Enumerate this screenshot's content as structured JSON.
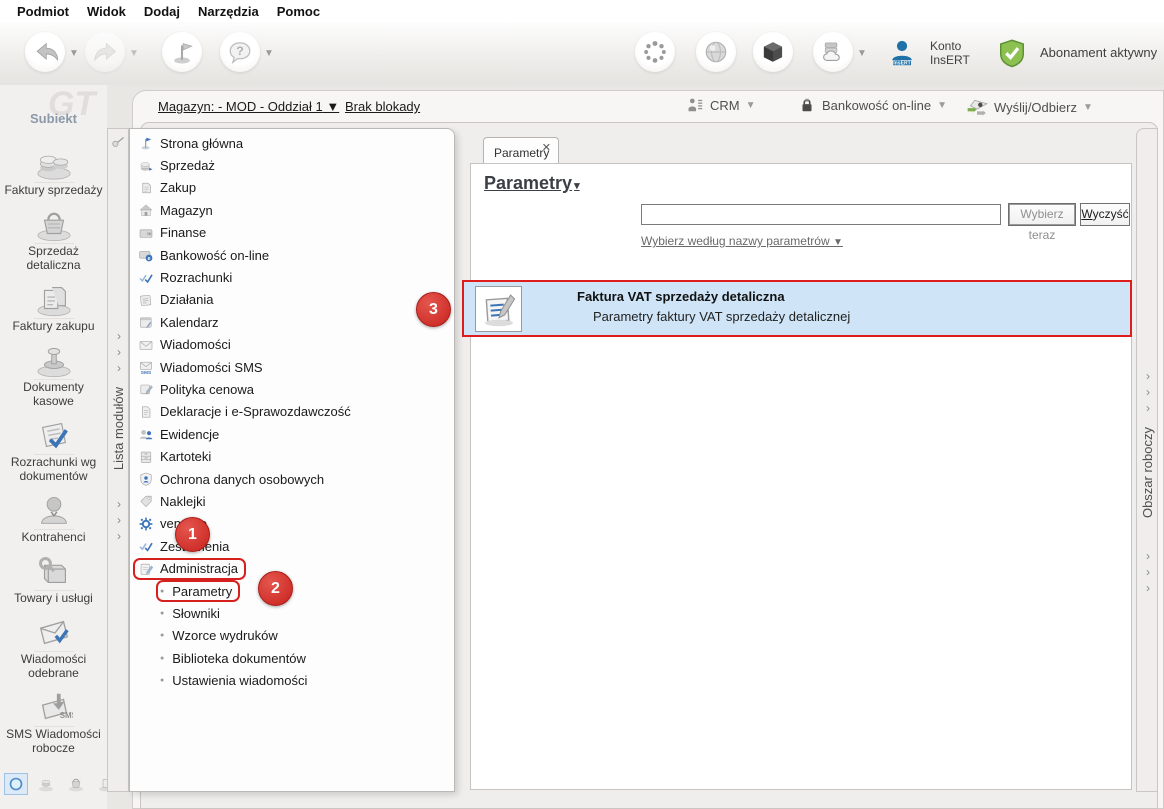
{
  "menu": {
    "items": [
      "Podmiot",
      "Widok",
      "Dodaj",
      "Narzędzia",
      "Pomoc"
    ]
  },
  "toolbar": {
    "left_buttons": [
      {
        "icon": "nav-back-icon",
        "caret": true,
        "disabled": false
      },
      {
        "icon": "nav-forward-icon",
        "caret": true,
        "disabled": true
      },
      {
        "icon": "flag-icon",
        "caret": false,
        "disabled": false
      },
      {
        "icon": "help-bubble-icon",
        "caret": true,
        "disabled": false
      }
    ],
    "right_buttons": [
      {
        "icon": "sync-dots-icon"
      },
      {
        "icon": "globe-icon"
      },
      {
        "icon": "cube-icon"
      },
      {
        "icon": "cloud-server-icon",
        "caret": true
      }
    ],
    "konto_label_line1": "Konto",
    "konto_label_line2": "InsERT",
    "abonament_label": "Abonament aktywny"
  },
  "statusbar": {
    "magazyn_label": "Magazyn: - MOD - Oddział 1",
    "lock_label": "Brak blokady",
    "crm_label": "CRM",
    "bank_label": "Bankowość on-line",
    "send_label": "Wyślij/Odbierz"
  },
  "sidebar": {
    "logo": "GT",
    "app_name": "Subiekt",
    "items": [
      {
        "label": "Faktury sprzedaży",
        "icon": "sales-invoices-icon"
      },
      {
        "label": "Sprzedaż detaliczna",
        "icon": "retail-sales-icon"
      },
      {
        "label": "Faktury zakupu",
        "icon": "purchase-invoices-icon"
      },
      {
        "label": "Dokumenty kasowe",
        "icon": "cash-documents-icon"
      },
      {
        "label": "Rozrachunki wg dokumentów",
        "icon": "settlements-by-documents-icon"
      },
      {
        "label": "Kontrahenci",
        "icon": "contractors-icon"
      },
      {
        "label": "Towary i usługi",
        "icon": "goods-services-icon"
      },
      {
        "label": "Wiadomości odebrane",
        "icon": "messages-received-icon"
      },
      {
        "label": "SMS Wiadomości robocze",
        "icon": "sms-draft-icon"
      }
    ],
    "bottom_icons": [
      "module-circle-icon",
      "module-sales-icon",
      "module-retail-icon",
      "module-purchase-icon"
    ]
  },
  "modules_panel": {
    "tab_label": "Lista modułów",
    "items": [
      {
        "label": "Strona główna",
        "icon": "home-flag-icon"
      },
      {
        "label": "Sprzedaż",
        "icon": "sales-icon"
      },
      {
        "label": "Zakup",
        "icon": "purchase-icon"
      },
      {
        "label": "Magazyn",
        "icon": "warehouse-icon"
      },
      {
        "label": "Finanse",
        "icon": "finance-icon"
      },
      {
        "label": "Bankowość on-line",
        "icon": "banking-icon"
      },
      {
        "label": "Rozrachunki",
        "icon": "settlements-icon"
      },
      {
        "label": "Działania",
        "icon": "actions-icon"
      },
      {
        "label": "Kalendarz",
        "icon": "calendar-icon"
      },
      {
        "label": "Wiadomości",
        "icon": "messages-icon"
      },
      {
        "label": "Wiadomości SMS",
        "icon": "sms-icon"
      },
      {
        "label": "Polityka cenowa",
        "icon": "pricing-icon"
      },
      {
        "label": "Deklaracje i e-Sprawozdawczość",
        "icon": "declarations-icon"
      },
      {
        "label": "Ewidencje",
        "icon": "records-icon"
      },
      {
        "label": "Kartoteki",
        "icon": "card-files-icon"
      },
      {
        "label": "Ochrona danych osobowych",
        "icon": "gdpr-shield-icon"
      },
      {
        "label": "Naklejki",
        "icon": "labels-icon"
      },
      {
        "label": "vendero",
        "icon": "vendero-gear-icon"
      },
      {
        "label": "Zestawienia",
        "icon": "reports-icon"
      },
      {
        "label": "Administracja",
        "icon": "administration-icon",
        "annotated": true,
        "children": [
          {
            "label": "Parametry",
            "annotated": true
          },
          {
            "label": "Słowniki"
          },
          {
            "label": "Wzorce wydruków"
          },
          {
            "label": "Biblioteka dokumentów"
          },
          {
            "label": "Ustawienia wiadomości"
          }
        ]
      }
    ]
  },
  "workspace_panel": {
    "tab_label": "Obszar roboczy"
  },
  "main": {
    "tab_label": "Parametry",
    "title": "Parametry",
    "search_value": "",
    "select_button": "Wybierz teraz",
    "clear_button": "Wyczyść",
    "filter_link": "Wybierz według nazwy parametrów",
    "result": {
      "title": "Faktura VAT sprzedaży detaliczna",
      "description": "Parametry faktury VAT sprzedaży detalicznej"
    }
  },
  "annotations": {
    "step1": "1",
    "step2": "2",
    "step3": "3"
  },
  "colors": {
    "annotation_red": "#d6201d",
    "selection_blue": "#cfe5f7",
    "accent_blue": "#3d74b8",
    "abonament_green": "#76b043"
  }
}
